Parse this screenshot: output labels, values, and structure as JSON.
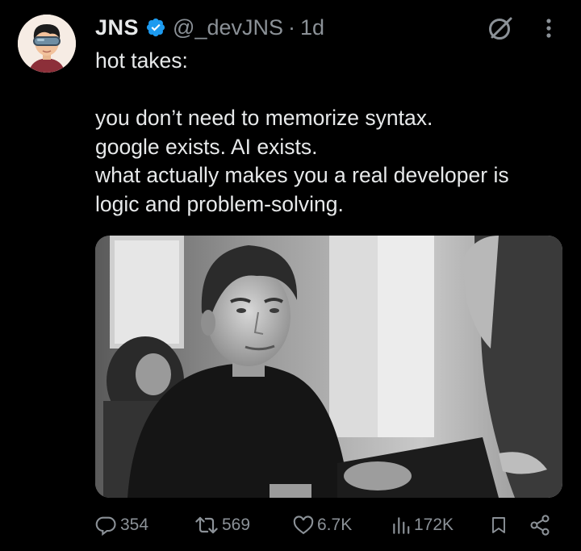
{
  "author": {
    "display_name": "JNS",
    "handle": "@_devJNS",
    "separator": "·",
    "timestamp": "1d",
    "verified": true,
    "verified_color": "#1d9bf0"
  },
  "tweet": {
    "lines": [
      "hot takes:",
      "",
      "you don’t need to memorize syntax.",
      "google exists. AI exists.",
      "what actually makes you a real developer is",
      "logic and problem-solving."
    ]
  },
  "media": {
    "kind": "photo",
    "style": "black-and-white"
  },
  "actions": {
    "replies": "354",
    "reposts": "569",
    "likes": "6.7K",
    "views": "172K"
  },
  "icons": {
    "verified": "verified-badge-icon",
    "grok": "grok-icon",
    "more": "more-options-icon",
    "reply": "reply-icon",
    "repost": "repost-icon",
    "like": "like-icon",
    "views": "views-icon",
    "bookmark": "bookmark-icon",
    "share": "share-icon"
  },
  "colors": {
    "background": "#000000",
    "text": "#e7e9ea",
    "secondary": "#8b9197",
    "accent": "#1d9bf0"
  }
}
